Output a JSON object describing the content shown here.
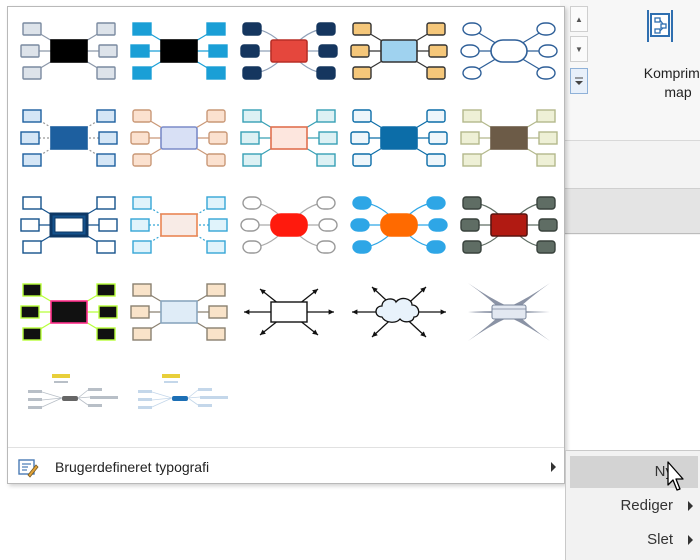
{
  "ribbon": {
    "compress_label": "Komprimer\nmap",
    "icons": {
      "scroll_up": "chevron-up-icon",
      "scroll_down": "chevron-down-icon",
      "more": "gallery-more-icon",
      "compress": "compress-map-icon"
    }
  },
  "gallery": {
    "themes": [
      {
        "name": "theme-black-center",
        "icon": "mindmap-theme-icon"
      },
      {
        "name": "theme-black-blue",
        "icon": "mindmap-theme-icon"
      },
      {
        "name": "theme-navy-red",
        "icon": "mindmap-theme-icon"
      },
      {
        "name": "theme-yellow-blue",
        "icon": "mindmap-theme-icon"
      },
      {
        "name": "theme-outline-blue",
        "icon": "mindmap-theme-icon"
      },
      {
        "name": "theme-blue-dotted",
        "icon": "mindmap-theme-icon"
      },
      {
        "name": "theme-peach-lavender",
        "icon": "mindmap-theme-icon"
      },
      {
        "name": "theme-teal-pink",
        "icon": "mindmap-theme-icon"
      },
      {
        "name": "theme-blue-solid",
        "icon": "mindmap-theme-icon"
      },
      {
        "name": "theme-olive-brown",
        "icon": "mindmap-theme-icon"
      },
      {
        "name": "theme-navy-outline",
        "icon": "mindmap-theme-icon"
      },
      {
        "name": "theme-cyan-orange",
        "icon": "mindmap-theme-icon"
      },
      {
        "name": "theme-gray-red-oval",
        "icon": "mindmap-theme-icon"
      },
      {
        "name": "theme-blue-orange-oval",
        "icon": "mindmap-theme-icon"
      },
      {
        "name": "theme-gray-darkred",
        "icon": "mindmap-theme-icon"
      },
      {
        "name": "theme-neon-black",
        "icon": "mindmap-theme-icon"
      },
      {
        "name": "theme-beige-lightblue",
        "icon": "mindmap-theme-icon"
      },
      {
        "name": "theme-arrows-box",
        "icon": "mindmap-theme-icon"
      },
      {
        "name": "theme-arrows-cloud",
        "icon": "mindmap-theme-icon"
      },
      {
        "name": "theme-gray-stars",
        "icon": "mindmap-theme-icon"
      },
      {
        "name": "theme-pale-gray",
        "icon": "mindmap-theme-icon"
      },
      {
        "name": "theme-pale-blue",
        "icon": "mindmap-theme-icon"
      }
    ],
    "custom_label": "Brugerdefineret typografi",
    "custom_icon": "custom-typography-icon"
  },
  "submenu": {
    "items": [
      {
        "label": "Ny",
        "has_arrow": false,
        "highlighted": true
      },
      {
        "label": "Rediger",
        "has_arrow": true,
        "highlighted": false
      },
      {
        "label": "Slet",
        "has_arrow": true,
        "highlighted": false
      }
    ]
  },
  "cursor": "mouse-pointer-icon"
}
